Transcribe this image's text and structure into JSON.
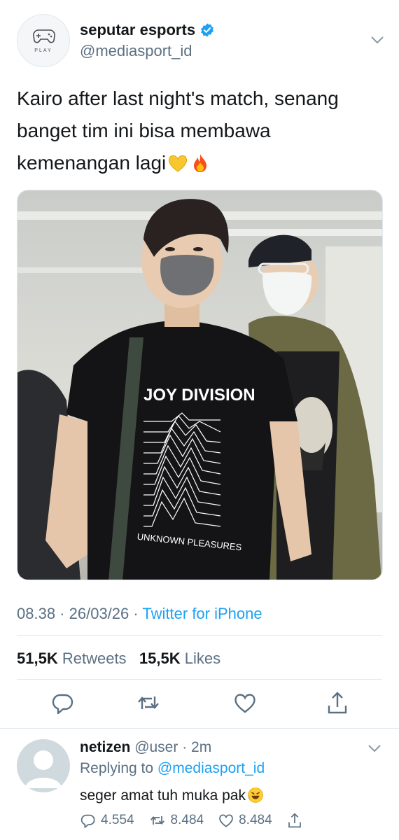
{
  "tweet": {
    "display_name": "seputar esports",
    "handle": "@mediasport_id",
    "avatar_label": "PLAY",
    "text": "Kairo after last night's match, senang banget tim ini bisa membawa kemenangan lagi",
    "emojis": [
      "yellow-heart",
      "fire"
    ],
    "media_alt": "photo",
    "time": "08.38",
    "date": "26/03/26",
    "source": "Twitter for iPhone",
    "retweets_count": "51,5K",
    "retweets_label": "Retweets",
    "likes_count": "15,5K",
    "likes_label": "Likes",
    "actions": [
      "reply-icon",
      "retweet-icon",
      "like-icon",
      "share-icon"
    ]
  },
  "reply": {
    "name": "netizen",
    "handle": "@user",
    "time": "2m",
    "replying_label": "Replying to",
    "replying_to": "@mediasport_id",
    "text": "seger amat tuh muka pak",
    "emoji": "rolling-on-floor-laughing",
    "reply_count": "4.554",
    "retweet_count": "8.484",
    "like_count": "8.484"
  },
  "colors": {
    "accent": "#1da1f2",
    "secondary_text": "#5b7083",
    "primary_text": "#14171a",
    "divider": "#e1e8ed"
  }
}
